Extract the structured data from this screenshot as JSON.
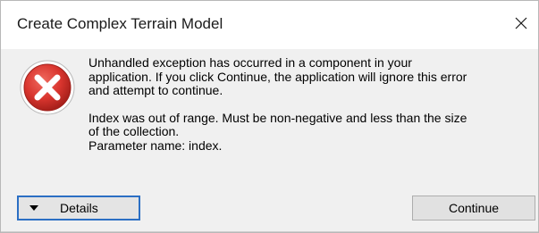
{
  "window": {
    "title": "Create Complex Terrain Model",
    "close_glyph": "✕"
  },
  "icon": {
    "name": "error-icon",
    "color": "#d9352e"
  },
  "message": {
    "paragraph1_lines": [
      "Unhandled exception has occurred in a component in your",
      "application. If you click Continue, the application will ignore this error",
      "and attempt to continue."
    ],
    "paragraph2_lines": [
      "Index was out of range. Must be non-negative and less than the size",
      "of the collection.",
      "Parameter name: index."
    ]
  },
  "buttons": {
    "details_label": "Details",
    "continue_label": "Continue"
  },
  "colors": {
    "focus_border": "#2b6fc4",
    "dialog_bg": "#f0f0f0"
  }
}
